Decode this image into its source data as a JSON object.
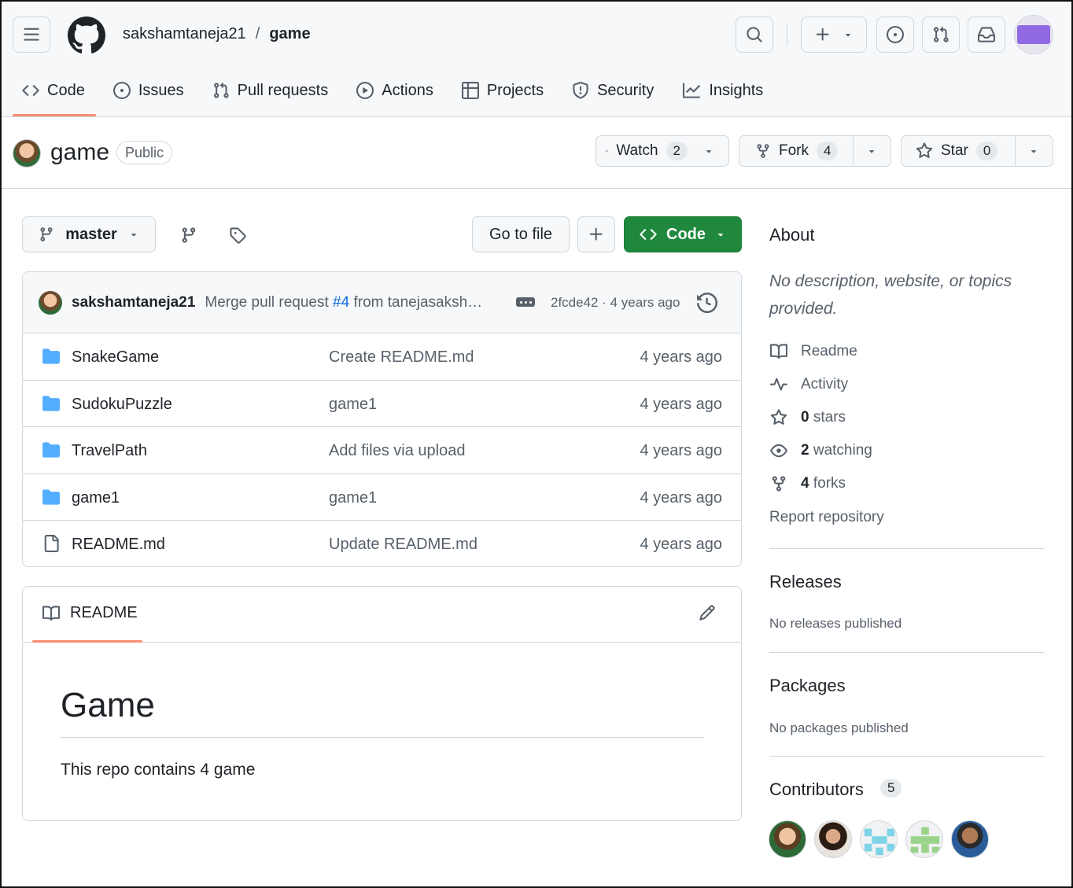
{
  "header": {
    "owner": "sakshamtaneja21",
    "separator": "/",
    "repo": "game"
  },
  "tabs": [
    {
      "label": "Code"
    },
    {
      "label": "Issues"
    },
    {
      "label": "Pull requests"
    },
    {
      "label": "Actions"
    },
    {
      "label": "Projects"
    },
    {
      "label": "Security"
    },
    {
      "label": "Insights"
    }
  ],
  "repo_bar": {
    "name": "game",
    "visibility": "Public",
    "watch_label": "Watch",
    "watch_count": "2",
    "fork_label": "Fork",
    "fork_count": "4",
    "star_label": "Star",
    "star_count": "0"
  },
  "toolbar": {
    "branch": "master",
    "go_to_file": "Go to file",
    "code_label": "Code"
  },
  "commit": {
    "author": "sakshamtaneja21",
    "message_prefix": "Merge pull request ",
    "pr_link": "#4",
    "message_suffix": " from tanejasaksh…",
    "hash_time": "2fcde42 · 4 years ago"
  },
  "files": [
    {
      "name": "SnakeGame",
      "type": "folder",
      "message": "Create README.md",
      "time": "4 years ago"
    },
    {
      "name": "SudokuPuzzle",
      "type": "folder",
      "message": "game1",
      "time": "4 years ago"
    },
    {
      "name": "TravelPath",
      "type": "folder",
      "message": "Add files via upload",
      "time": "4 years ago"
    },
    {
      "name": "game1",
      "type": "folder",
      "message": "game1",
      "time": "4 years ago"
    },
    {
      "name": "README.md",
      "type": "file",
      "message": "Update README.md",
      "time": "4 years ago"
    }
  ],
  "readme": {
    "tab_label": "README",
    "heading": "Game",
    "body": "This repo contains 4 game"
  },
  "sidebar": {
    "about_title": "About",
    "about_desc": "No description, website, or topics provided.",
    "readme_label": "Readme",
    "activity_label": "Activity",
    "stars_count": "0",
    "stars_label": "stars",
    "watching_count": "2",
    "watching_label": "watching",
    "forks_count": "4",
    "forks_label": "forks",
    "report_label": "Report repository",
    "releases_title": "Releases",
    "releases_empty": "No releases published",
    "packages_title": "Packages",
    "packages_empty": "No packages published",
    "contributors_title": "Contributors",
    "contributors_count": "5"
  },
  "colors": {
    "accent_underline": "#fd8c73",
    "green_button": "#1f883d",
    "link": "#0969da",
    "folder": "#54aeff"
  }
}
